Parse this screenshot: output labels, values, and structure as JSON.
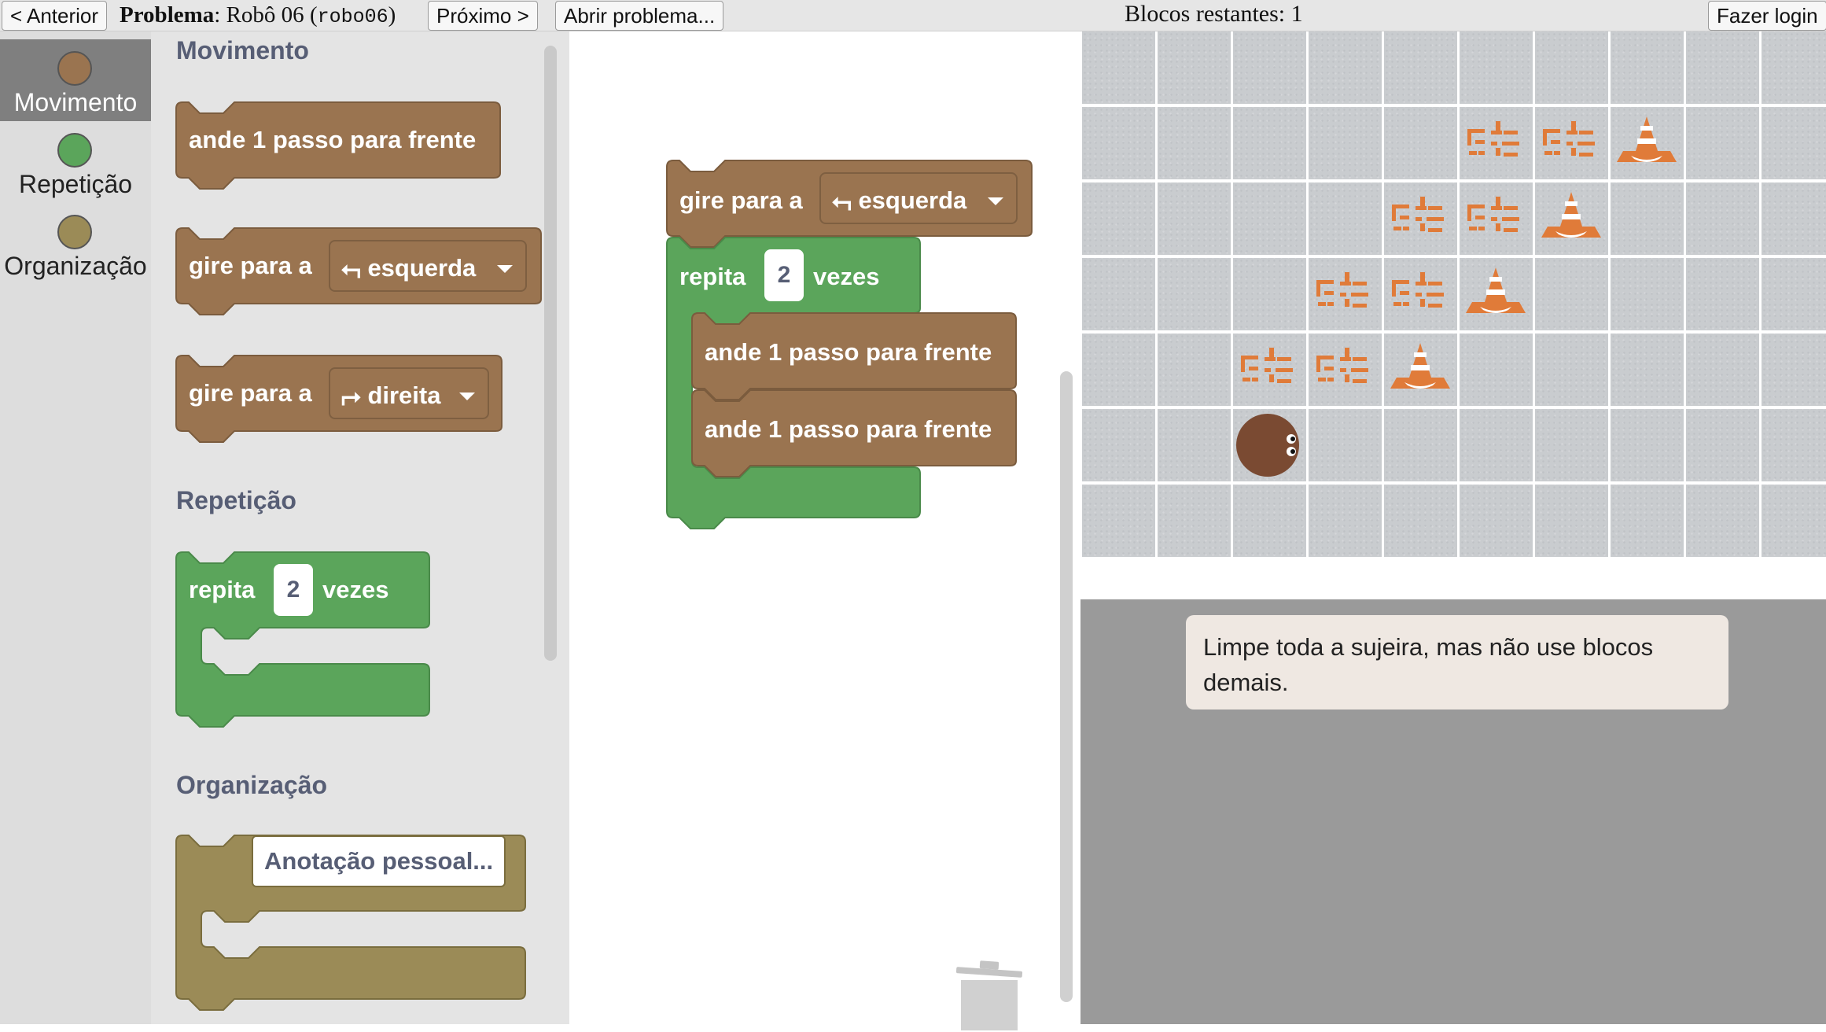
{
  "topbar": {
    "prev_label": "< Anterior",
    "problem_label": "Problema",
    "problem_name": "Robô 06",
    "problem_code": "robo06",
    "next_label": "Próximo >",
    "open_label": "Abrir problema...",
    "remaining_text": "Blocos restantes: 1",
    "login_label": "Fazer login"
  },
  "categories": [
    {
      "label": "Movimento",
      "color": "#9a7450",
      "selected": true
    },
    {
      "label": "Repetição",
      "color": "#5ba55b",
      "selected": false
    },
    {
      "label": "Organização",
      "color": "#9b8b57",
      "selected": false
    }
  ],
  "flyout": {
    "heading_movement": "Movimento",
    "heading_repeat": "Repetição",
    "heading_org": "Organização",
    "forward_label": "ande 1 passo para frente",
    "turn_label": "gire para a",
    "left_arrow": "⮢",
    "left_option": "esquerda",
    "right_arrow": "⮣",
    "right_option": "direita",
    "repeat_label": "repita",
    "repeat_count": "2",
    "times_label": "vezes",
    "note_placeholder": "Anotação pessoal..."
  },
  "workspace": {
    "turn_label": "gire para a",
    "turn_arrow": "⮢",
    "turn_option": "esquerda",
    "repeat_label": "repita",
    "repeat_count": "2",
    "times_label": "vezes",
    "step1_label": "ande 1 passo para frente",
    "step2_label": "ande 1 passo para frente"
  },
  "colors": {
    "motion": "#9a7450",
    "motion_dark": "#7b5c3e",
    "loop": "#5ba55b",
    "loop_dark": "#4a8a4a",
    "org": "#9b8b57",
    "org_dark": "#7a6d3e",
    "cone": "#e07b39",
    "dirt": "#e07b39",
    "robot": "#7a4a32"
  },
  "board": {
    "cols": 10,
    "rows": 7,
    "dirt_cells": [
      [
        5,
        1
      ],
      [
        6,
        1
      ],
      [
        4,
        2
      ],
      [
        5,
        2
      ],
      [
        3,
        3
      ],
      [
        4,
        3
      ],
      [
        2,
        4
      ],
      [
        3,
        4
      ]
    ],
    "cone_cells": [
      [
        7,
        1
      ],
      [
        6,
        2
      ],
      [
        5,
        3
      ],
      [
        4,
        4
      ]
    ],
    "robot_cell": [
      2,
      5
    ],
    "robot_facing": "right"
  },
  "hint_text": "Limpe toda a sujeira, mas não use blocos demais."
}
